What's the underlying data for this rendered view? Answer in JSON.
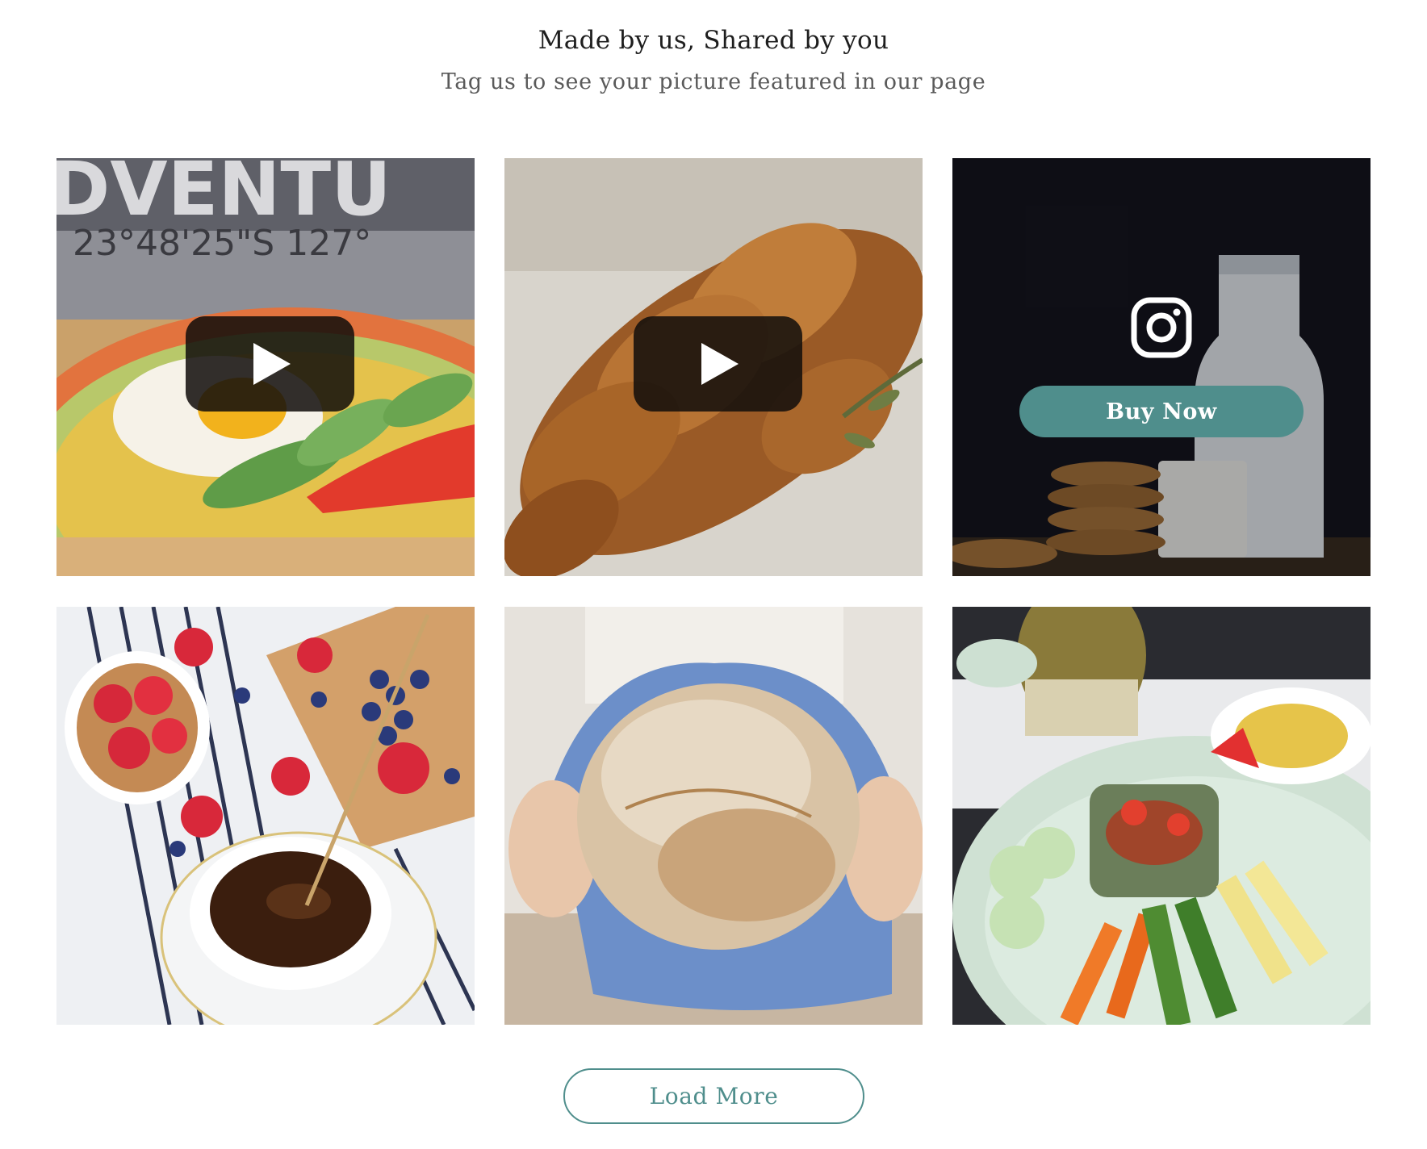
{
  "section": {
    "heading": "Made by us, Shared by you",
    "subheading": "Tag us to see your picture featured in our page"
  },
  "gallery": {
    "tiles": [
      {
        "subject": "fried egg with cucumber and tomato on a decorated plate",
        "media": "video",
        "control_icon": "play-icon"
      },
      {
        "subject": "braided sesame bread loaf on linen",
        "media": "video",
        "control_icon": "play-icon"
      },
      {
        "subject": "milk bottle, glass of milk and stacked cookies on dark background",
        "media": "hover",
        "control_icon": "instagram-icon",
        "button_label": "Buy Now"
      },
      {
        "subject": "strawberries, blueberry toast and a cup of coffee on striped cloth",
        "media": "photo"
      },
      {
        "subject": "hands holding a round rustic sourdough loaf in a blue towel",
        "media": "photo"
      },
      {
        "subject": "thai salad platter with vegetables, dip bowl and coconut",
        "media": "photo"
      }
    ]
  },
  "actions": {
    "load_more_label": "Load More"
  },
  "colors": {
    "accent": "#4f8e8c",
    "heading_text": "#1e1e1e",
    "subheading_text": "#5a5a5a",
    "play_button_bg": "#120e0c"
  }
}
